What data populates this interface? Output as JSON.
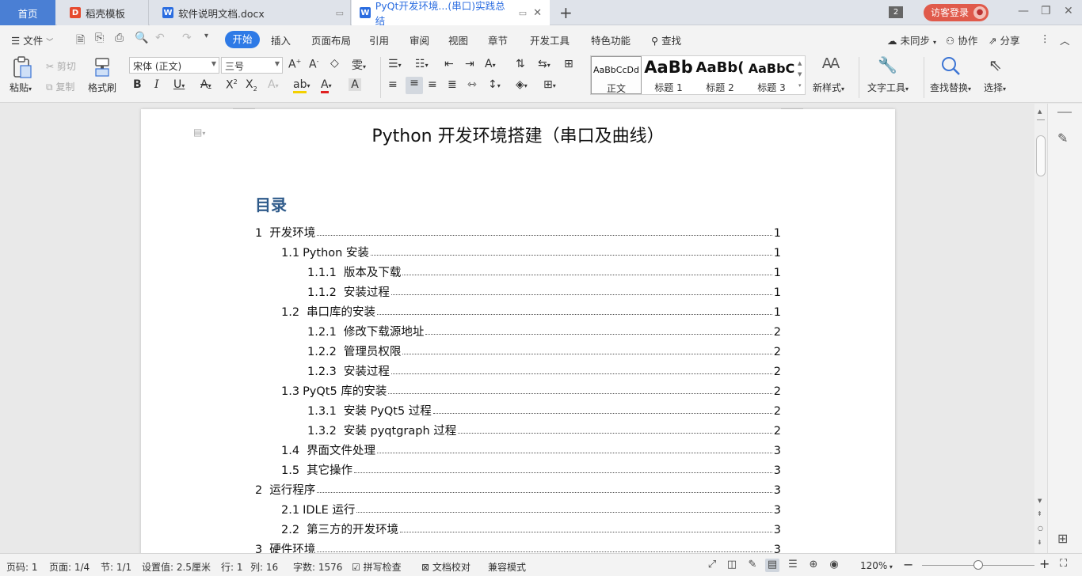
{
  "tabs": {
    "home": "首页",
    "items": [
      {
        "label": "稻壳模板"
      },
      {
        "label": "软件说明文档.docx"
      },
      {
        "label": "PyQt开发环境...(串口)实践总结"
      }
    ],
    "window_count": "2",
    "login": "访客登录"
  },
  "menu": {
    "file": "文件",
    "items": [
      "开始",
      "插入",
      "页面布局",
      "引用",
      "审阅",
      "视图",
      "章节",
      "开发工具",
      "特色功能"
    ],
    "search": "查找",
    "sync": "未同步",
    "collab": "协作",
    "share": "分享"
  },
  "ribbon": {
    "paste": "粘贴",
    "cut": "剪切",
    "copy": "复制",
    "format_painter": "格式刷",
    "font_name": "宋体 (正文)",
    "font_size": "三号",
    "styles": [
      {
        "preview": "AaBbCcDd",
        "name": "正文"
      },
      {
        "preview": "AaBb",
        "name": "标题 1"
      },
      {
        "preview": "AaBb(",
        "name": "标题 2"
      },
      {
        "preview": "AaBbC",
        "name": "标题 3"
      }
    ],
    "new_style": "新样式",
    "text_tools": "文字工具",
    "find_replace": "查找替换",
    "select": "选择"
  },
  "document": {
    "title": "Python 开发环境搭建（串口及曲线）",
    "toc_heading": "目录",
    "toc": [
      {
        "num": "1",
        "text": "开发环境",
        "page": "1",
        "level": 1
      },
      {
        "num": "1.1",
        "text": "Python 安装",
        "page": "1",
        "level": 2
      },
      {
        "num": "1.1.1",
        "text": "版本及下载",
        "page": "1",
        "level": 3
      },
      {
        "num": "1.1.2",
        "text": "安装过程",
        "page": "1",
        "level": 3
      },
      {
        "num": "1.2",
        "text": "串口库的安装",
        "page": "1",
        "level": 2
      },
      {
        "num": "1.2.1",
        "text": "修改下载源地址",
        "page": "2",
        "level": 3
      },
      {
        "num": "1.2.2",
        "text": "管理员权限",
        "page": "2",
        "level": 3
      },
      {
        "num": "1.2.3",
        "text": "安装过程",
        "page": "2",
        "level": 3
      },
      {
        "num": "1.3",
        "text": "PyQt5 库的安装",
        "page": "2",
        "level": 2
      },
      {
        "num": "1.3.1",
        "text": "安装 PyQt5 过程",
        "page": "2",
        "level": 3
      },
      {
        "num": "1.3.2",
        "text": "安装 pyqtgraph 过程",
        "page": "2",
        "level": 3
      },
      {
        "num": "1.4",
        "text": "界面文件处理",
        "page": "3",
        "level": 2
      },
      {
        "num": "1.5",
        "text": "其它操作",
        "page": "3",
        "level": 2
      },
      {
        "num": "2",
        "text": "运行程序",
        "page": "3",
        "level": 1
      },
      {
        "num": "2.1",
        "text": "IDLE 运行",
        "page": "3",
        "level": 2
      },
      {
        "num": "2.2",
        "text": "第三方的开发环境",
        "page": "3",
        "level": 2
      },
      {
        "num": "3",
        "text": "硬件环境",
        "page": "3",
        "level": 1
      }
    ]
  },
  "status": {
    "page_no": "页码: 1",
    "pages": "页面: 1/4",
    "section": "节: 1/1",
    "setting": "设置值: 2.5厘米",
    "row": "行: 1",
    "col": "列: 16",
    "words": "字数: 1576",
    "spell": "拼写检查",
    "proof": "文档校对",
    "compat": "兼容模式",
    "zoom": "120%"
  },
  "colors": {
    "accent": "#2e7ae6",
    "home_tab": "#4a7fd4",
    "login": "#e05a4b",
    "toc_heading": "#2e5a8a"
  }
}
